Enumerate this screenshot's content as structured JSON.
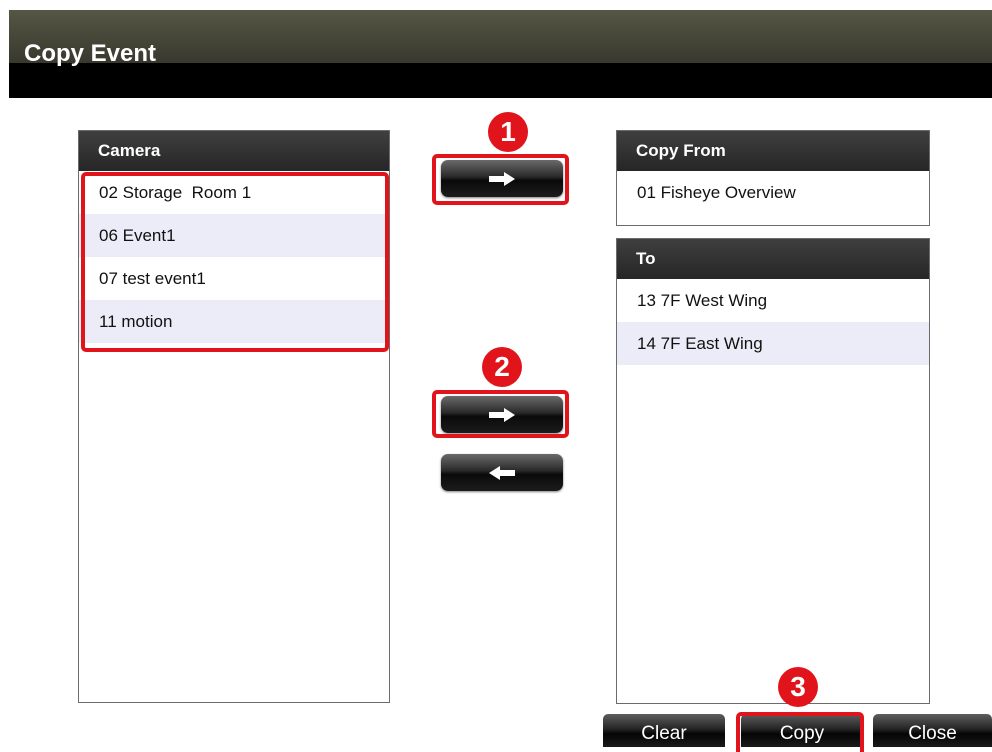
{
  "window": {
    "title": "Copy Event"
  },
  "camera_list": {
    "header": "Camera",
    "items": [
      "02 Storage  Room 1",
      "06 Event1",
      "07 test event1",
      "11 motion"
    ]
  },
  "copy_from": {
    "header": "Copy From",
    "items": [
      "01 Fisheye Overview"
    ]
  },
  "to_list": {
    "header": "To",
    "items": [
      "13 7F West Wing",
      "14 7F East Wing"
    ]
  },
  "buttons": {
    "add_source_icon": "right-arrow-icon",
    "add_target_icon": "right-arrow-icon",
    "remove_target_icon": "left-arrow-icon",
    "clear": "Clear",
    "copy": "Copy",
    "close": "Close"
  },
  "callouts": {
    "step1": "1",
    "step2": "2",
    "step3": "3"
  },
  "colors": {
    "highlight": "#e1141b",
    "alt_row": "#ececf8"
  }
}
